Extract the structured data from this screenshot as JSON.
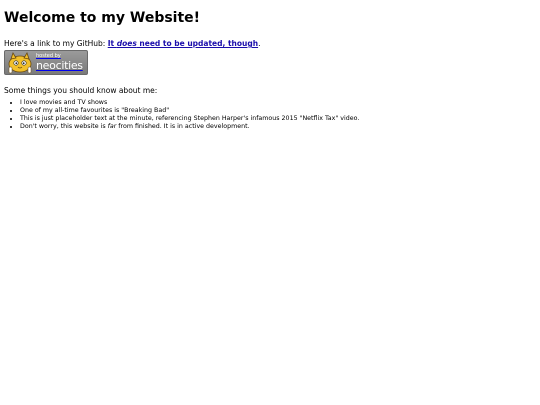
{
  "heading": "Welcome to my Website!",
  "github": {
    "prefix": "Here's a link to my GitHub: ",
    "link_part1": "It ",
    "link_emph": "does",
    "link_part2": " need to be updated, though",
    "suffix": "."
  },
  "badge": {
    "small_text": "hosted by",
    "brand": "neocities",
    "icon": "neocities-cat-icon"
  },
  "intro": "Some things you should know about me:",
  "facts": [
    "I love movies and TV shows",
    "One of my all-time favourites is \"Breaking Bad\"",
    "This is just placeholder text at the minute, referencing Stephen Harper's infamous 2015 \"Netflix Tax\" video."
  ],
  "last_fact": {
    "before": "Don't worry, this website is ",
    "emph": "far",
    "after": " from finished. It is in active development."
  },
  "colors": {
    "link": "#1a0dab",
    "badge_bg": "#8a8a8a"
  }
}
